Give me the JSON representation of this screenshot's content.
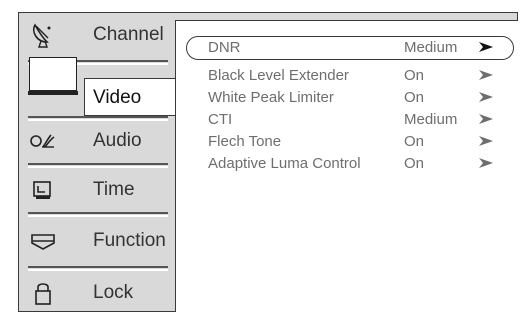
{
  "sidebar": {
    "items": [
      {
        "label": "Channel",
        "icon": "satellite-dish-icon"
      },
      {
        "label": "Video",
        "icon": "tv-icon"
      },
      {
        "label": "Audio",
        "icon": "audio-icon"
      },
      {
        "label": "Time",
        "icon": "clock-icon"
      },
      {
        "label": "Function",
        "icon": "function-icon"
      },
      {
        "label": "Lock",
        "icon": "lock-icon"
      }
    ]
  },
  "settings": {
    "rows": [
      {
        "name": "DNR",
        "value": "Medium"
      },
      {
        "name": "Black Level Extender",
        "value": "On"
      },
      {
        "name": "White Peak Limiter",
        "value": "On"
      },
      {
        "name": "CTI",
        "value": "Medium"
      },
      {
        "name": "Flech Tone",
        "value": "On"
      },
      {
        "name": "Adaptive Luma Control",
        "value": "On"
      }
    ]
  }
}
